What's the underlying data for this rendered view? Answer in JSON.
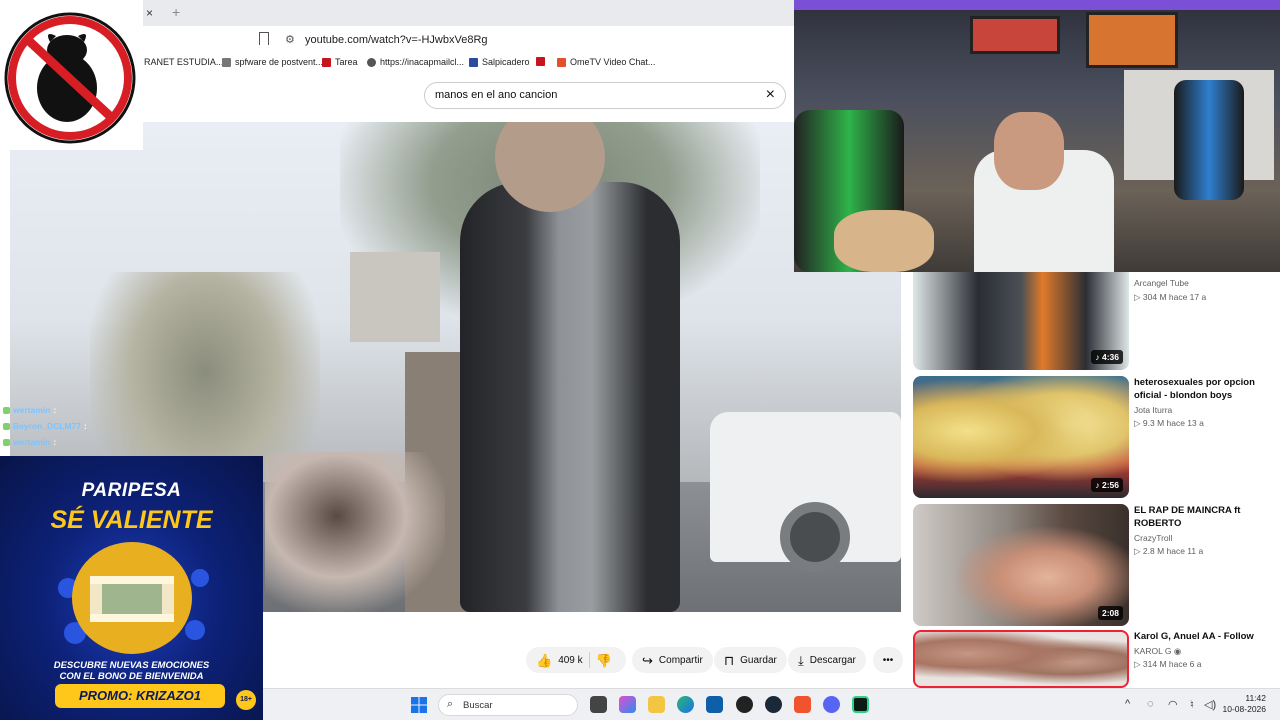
{
  "browser": {
    "tab_close": "×",
    "tab_new": "+",
    "url": "youtube.com/watch?v=-HJwbxVe8Rg",
    "bookmarks": [
      {
        "label": "RANET ESTUDIA...",
        "color": ""
      },
      {
        "label": "spfware de postvent...",
        "color": "#777777"
      },
      {
        "label": "Tarea",
        "color": "#c4161c"
      },
      {
        "label": "https://inacapmailcl...",
        "color": "#555555"
      },
      {
        "label": "Salpicadero",
        "color": "#2b4aa0"
      },
      {
        "label": "",
        "color": "#c4161c"
      },
      {
        "label": "OmeTV Video Chat...",
        "color": "#e0522b"
      }
    ]
  },
  "search": {
    "query": "manos en el ano cancion",
    "clear": "×"
  },
  "actions": {
    "like_count": "409 k",
    "share": "Compartir",
    "save": "Guardar",
    "download": "Descargar",
    "more": "•••"
  },
  "recommended": [
    {
      "title": "",
      "channel": "Arcangel Tube",
      "meta": "▷ 304 M  hace 17 a",
      "duration": "♪ 4:36"
    },
    {
      "title": "heterosexuales por opcion oficial - blondon boys",
      "channel": "Jota Iturra",
      "meta": "▷ 9.3 M  hace 13 a",
      "duration": "♪ 2:56"
    },
    {
      "title": "EL RAP DE MAINCRA ft ROBERTO",
      "channel": "CrazyTroll",
      "meta": "▷ 2.8 M  hace 11 a",
      "duration": "2:08"
    },
    {
      "title": "Karol G, Anuel AA - Follow",
      "channel": "KAROL G ◉",
      "meta": "▷ 314 M  hace 6 a",
      "duration": ""
    }
  ],
  "chat": [
    {
      "user": "wertamin",
      "msg": ":"
    },
    {
      "user": "Beyron_DCLM77",
      "msg": ":"
    },
    {
      "user": "wertamin",
      "msg": ":"
    }
  ],
  "ad": {
    "brand": "PARIPESA",
    "headline": "SÉ VALIENTE",
    "sub_line1": "DESCUBRE NUEVAS EMOCIONES",
    "sub_line2": "CON EL BONO DE BIENVENIDA",
    "promo": "PROMO: KRIZAZO1",
    "age": "18+"
  },
  "taskbar": {
    "search_placeholder": "Buscar",
    "time": "11:42",
    "date": "10-08-2026",
    "tray_chevron": "^"
  },
  "colors": {
    "yt_red": "#ff0000",
    "ad_gold": "#ffc719",
    "ad_blue": "#0d2279"
  }
}
